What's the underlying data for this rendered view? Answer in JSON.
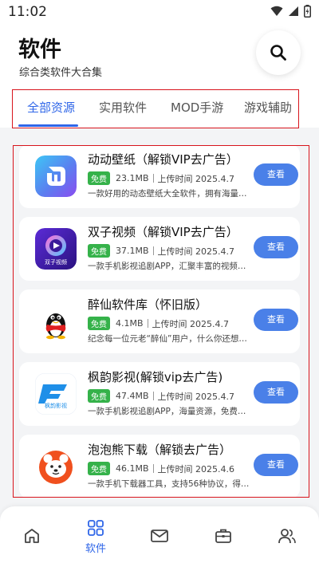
{
  "status_bar": {
    "time": "11:02"
  },
  "header": {
    "title": "软件",
    "subtitle": "综合类软件大合集"
  },
  "tabs": [
    {
      "label": "全部资源",
      "active": true
    },
    {
      "label": "实用软件",
      "active": false
    },
    {
      "label": "MOD手游",
      "active": false
    },
    {
      "label": "游戏辅助",
      "active": false
    }
  ],
  "apps": [
    {
      "name": "动动壁纸（解锁VIP去广告）",
      "badge": "免费",
      "size": "23.1MB",
      "upload": "上传时间 2025.4.7",
      "desc": "一款好用的动态壁纸大全软件，拥有海量…",
      "button": "查看",
      "icon": "dongdong-wallpaper-logo"
    },
    {
      "name": "双子视频（解锁VIP去广告）",
      "badge": "免费",
      "size": "37.1MB",
      "upload": "上传时间 2025.4.7",
      "desc": "一款手机影视追剧APP，汇聚丰富的视频…",
      "button": "查看",
      "icon": "shuangzi-video-logo",
      "icon_text": "双子视频"
    },
    {
      "name": "醉仙软件库（怀旧版）",
      "badge": "免费",
      "size": "4.1MB",
      "upload": "上传时间 2025.4.7",
      "desc": "纪念每一位元老“醉仙”用户，什么你还想…",
      "button": "查看",
      "icon": "penguin-logo"
    },
    {
      "name": "枫韵影视(解锁vip去广告)",
      "badge": "免费",
      "size": "47.4MB",
      "upload": "上传时间 2025.4.7",
      "desc": "一款手机影视追剧APP，海量资源，免费…",
      "button": "查看",
      "icon": "fengyun-video-logo",
      "icon_text": "枫韵影视"
    },
    {
      "name": "泡泡熊下载（解锁去广告）",
      "badge": "免费",
      "size": "46.1MB",
      "upload": "上传时间 2025.4.6",
      "desc": "一款手机下载器工具，支持56种协议，得…",
      "button": "查看",
      "icon": "bear-logo"
    }
  ],
  "bottom_nav": [
    {
      "icon": "home-icon",
      "label": "",
      "active": false
    },
    {
      "icon": "grid-apps-icon",
      "label": "软件",
      "active": true
    },
    {
      "icon": "mail-icon",
      "label": "",
      "active": false
    },
    {
      "icon": "toolbox-icon",
      "label": "",
      "active": false
    },
    {
      "icon": "users-icon",
      "label": "",
      "active": false
    }
  ],
  "colors": {
    "accent": "#2f66e8",
    "badge_green": "#35b24a",
    "view_button": "#4a80e8",
    "highlight_border": "#d8141c"
  }
}
